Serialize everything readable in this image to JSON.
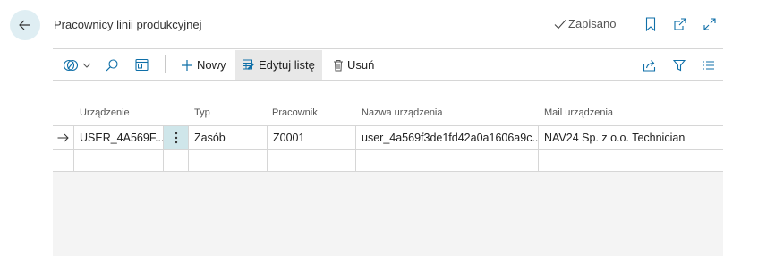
{
  "page": {
    "title": "Pracownicy linii produkcyjnej",
    "saved_status": "Zapisano"
  },
  "icons": {
    "back": "arrow-left-icon",
    "saved": "checkmark-icon",
    "bookmark": "bookmark-icon",
    "open_new": "open-in-new-window-icon",
    "expand": "expand-icon",
    "filter_pane": "filter-pane-icon",
    "search": "search-icon",
    "view": "view-icon",
    "new": "plus-icon",
    "edit_list": "edit-list-icon",
    "delete": "trash-icon",
    "share": "share-icon",
    "filter": "funnel-icon",
    "list_view": "list-lines-icon",
    "row_arrow": "arrow-right-icon",
    "row_menu": "vertical-ellipsis-icon"
  },
  "toolbar": {
    "new_label": "Nowy",
    "edit_list_label": "Edytuj listę",
    "delete_label": "Usuń"
  },
  "table": {
    "columns": [
      "Urządzenie",
      "Typ",
      "Pracownik",
      "Nazwa urządzenia",
      "Mail urządzenia"
    ],
    "rows": [
      {
        "device": "USER_4A569F...",
        "type": "Zasób",
        "worker": "Z0001",
        "device_name": "user_4a569f3de1fd42a0a1606a9c...",
        "device_mail": "NAV24 Sp. z o.o. Technician"
      }
    ]
  },
  "colors": {
    "accent": "#0f6fa8",
    "back_button_bg": "#dfeef3",
    "selected_cell_bg": "#cfe6ea",
    "empty_area_bg": "#f4f4f4"
  }
}
